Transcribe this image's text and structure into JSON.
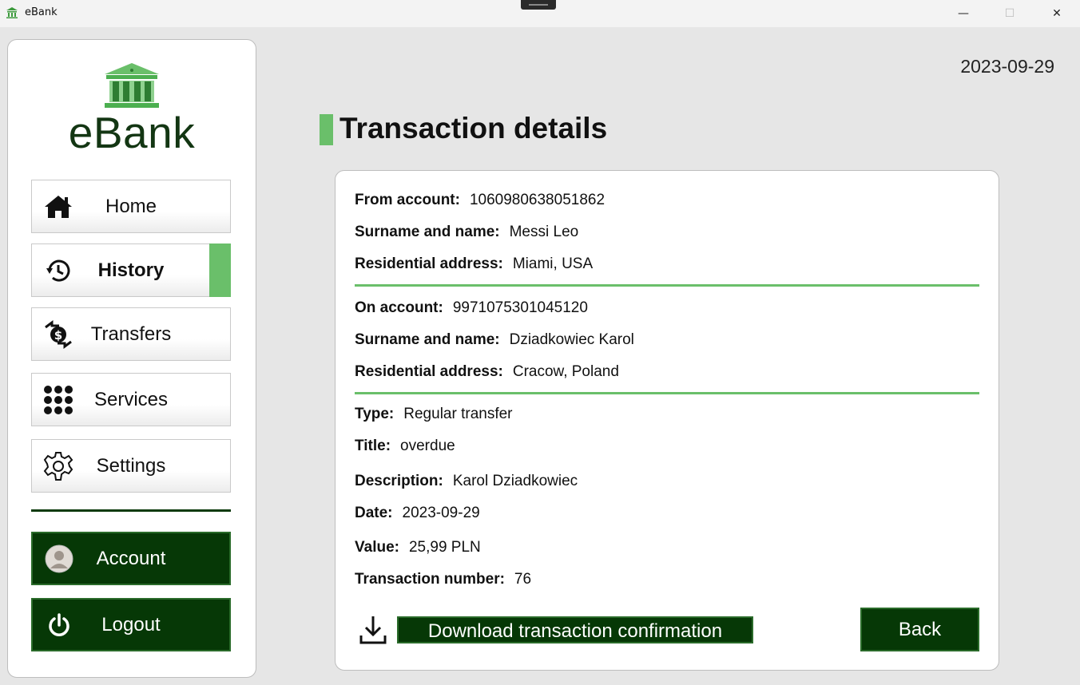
{
  "window": {
    "title": "eBank",
    "minimize": "—",
    "maximize": "☐",
    "close": "✕"
  },
  "sidebar": {
    "logo_text": "eBank",
    "nav": [
      {
        "label": "Home",
        "icon": "home-icon"
      },
      {
        "label": "History",
        "icon": "history-icon",
        "active": true
      },
      {
        "label": "Transfers",
        "icon": "transfers-icon"
      },
      {
        "label": "Services",
        "icon": "services-icon"
      },
      {
        "label": "Settings",
        "icon": "gear-icon"
      }
    ],
    "account_label": "Account",
    "logout_label": "Logout"
  },
  "header": {
    "date": "2023-09-29",
    "title": "Transaction details"
  },
  "details": {
    "from": {
      "account_label": "From account:",
      "account_value": "1060980638051862",
      "name_label": "Surname and name:",
      "name_value": "Messi Leo",
      "address_label": "Residential address:",
      "address_value": "Miami, USA"
    },
    "to": {
      "account_label": "On account:",
      "account_value": "9971075301045120",
      "name_label": "Surname and name:",
      "name_value": "Dziadkowiec Karol",
      "address_label": "Residential address:",
      "address_value": "Cracow, Poland"
    },
    "info": {
      "type_label": "Type:",
      "type_value": "Regular transfer",
      "title_label": "Title:",
      "title_value": "overdue",
      "description_label": "Description:",
      "description_value": "Karol Dziadkowiec",
      "date_label": "Date:",
      "date_value": "2023-09-29",
      "value_label": "Value:",
      "value_value": "25,99 PLN",
      "number_label": "Transaction number:",
      "number_value": "76"
    }
  },
  "actions": {
    "download_label": "Download transaction confirmation",
    "back_label": "Back"
  },
  "colors": {
    "accent_green": "#6abf6a",
    "dark_green": "#063806",
    "logo_green": "#133613"
  }
}
